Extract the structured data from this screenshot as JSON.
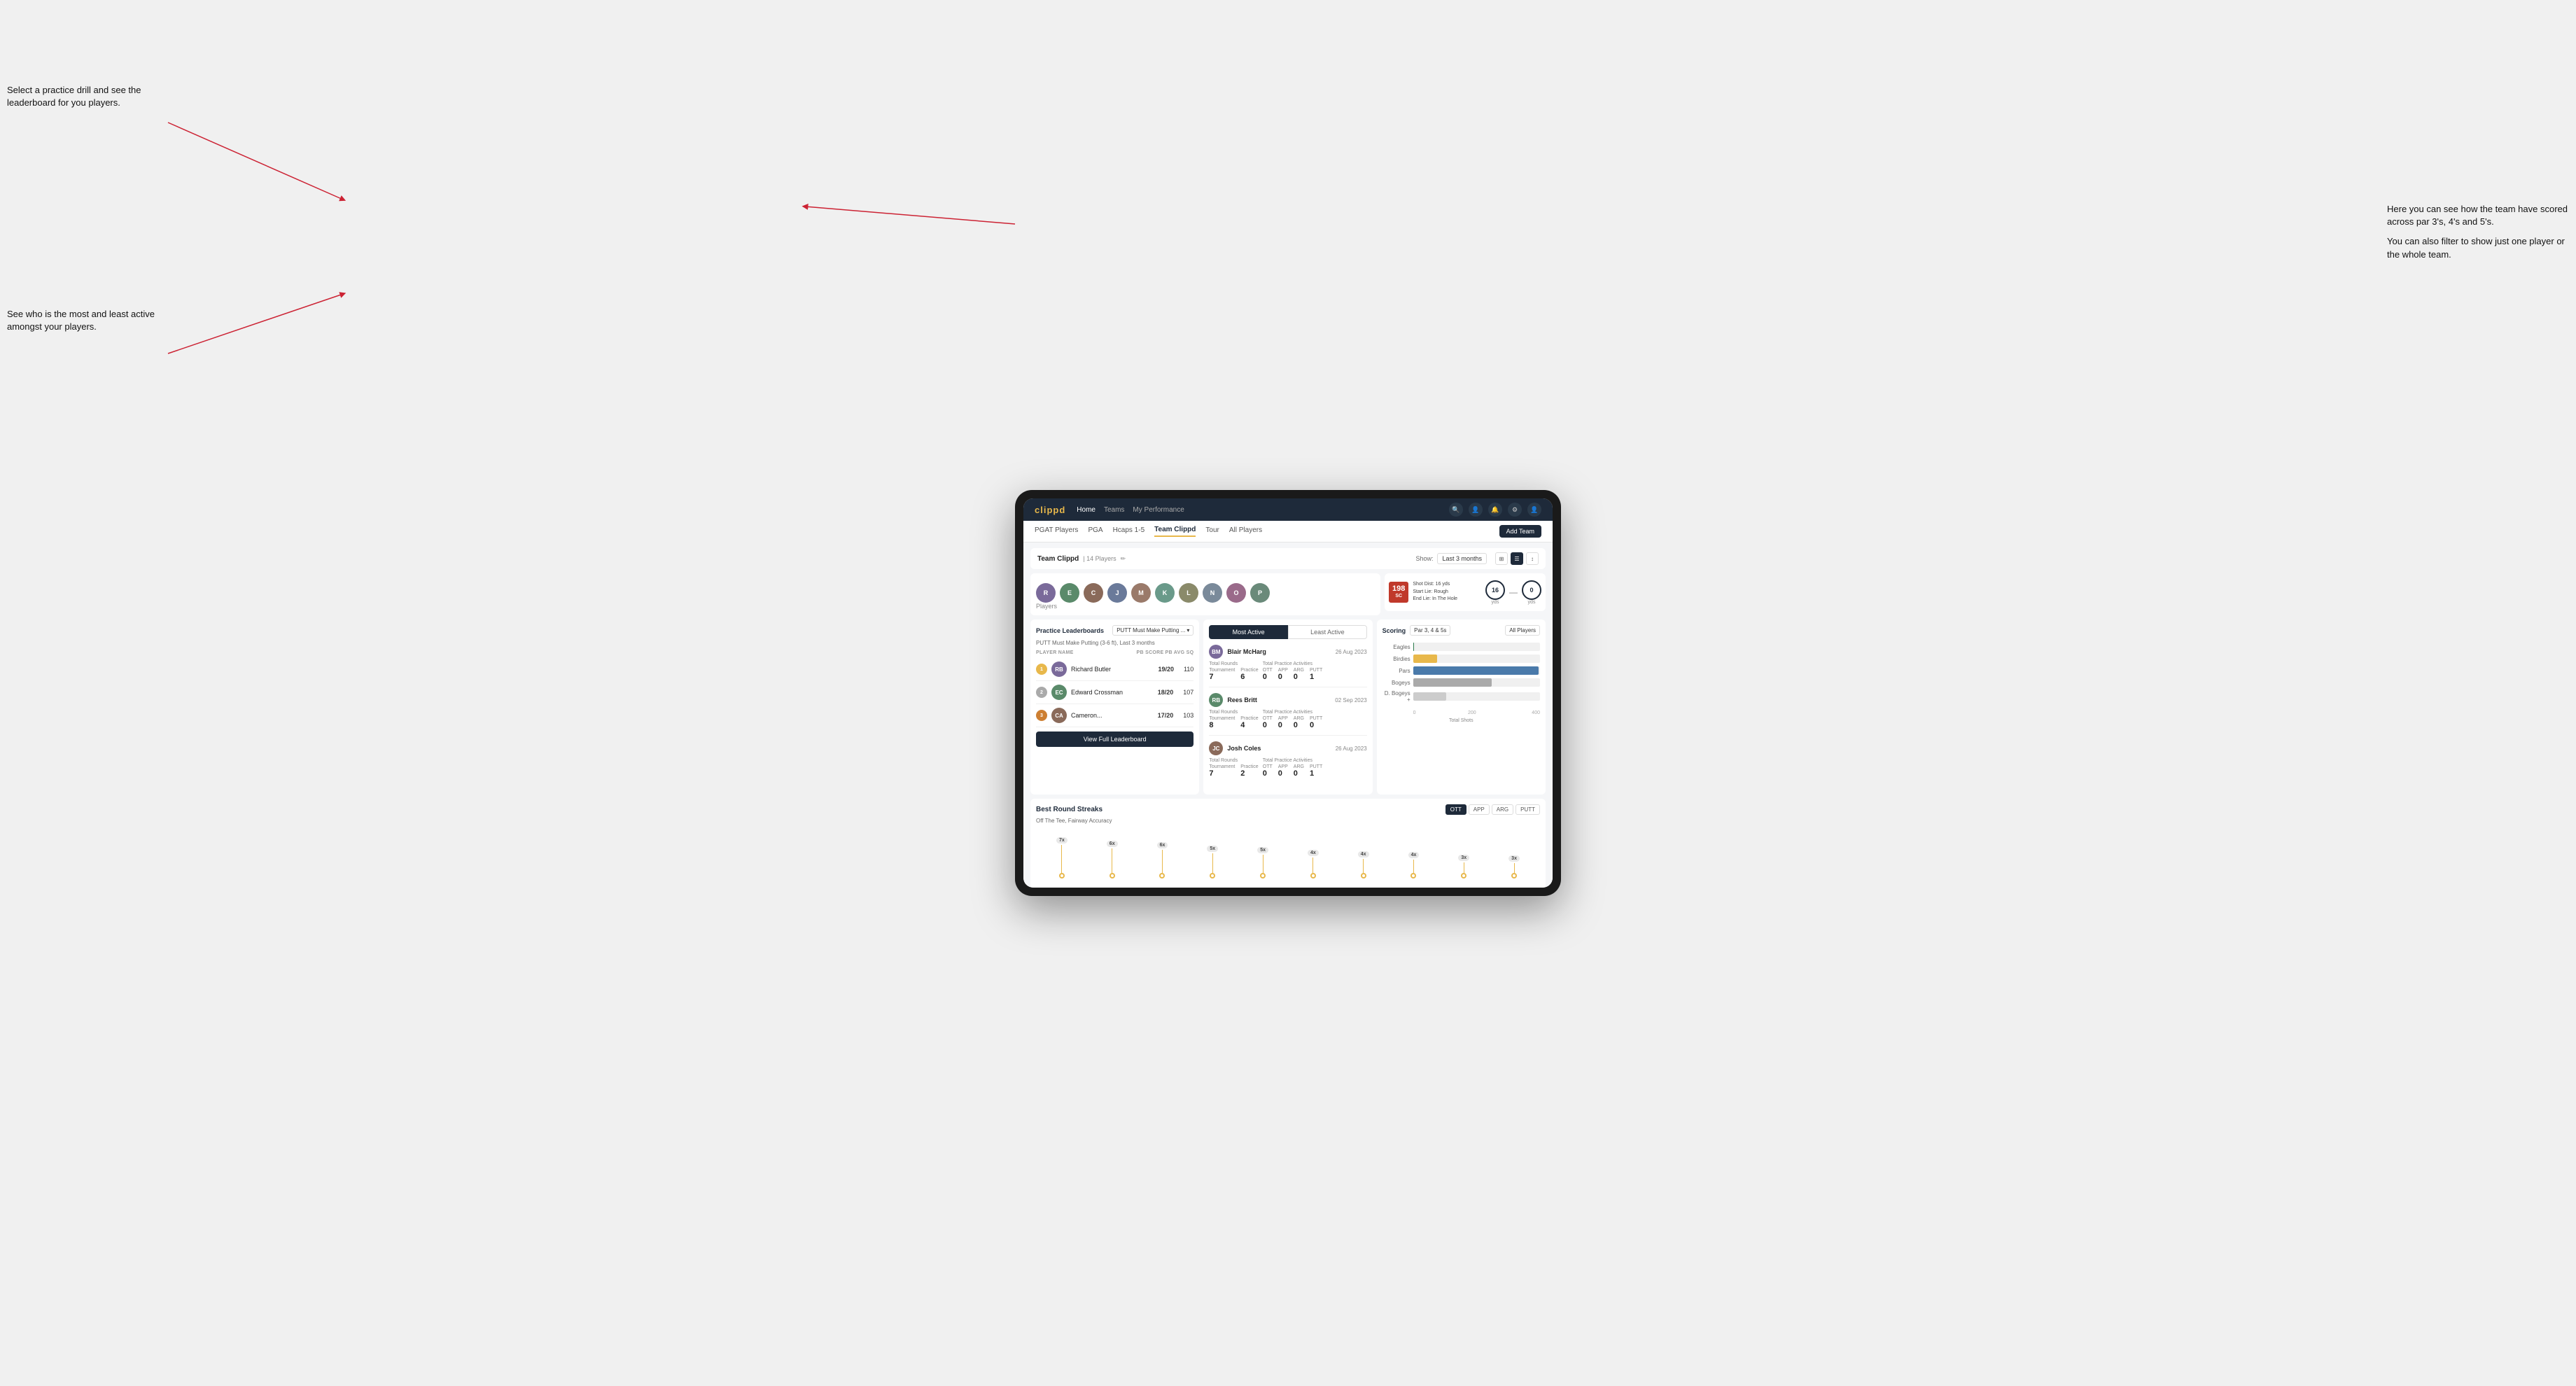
{
  "annotations": {
    "top_left": "Select a practice drill and see the leaderboard for you players.",
    "bottom_left": "See who is the most and least active amongst your players.",
    "top_right_line1": "Here you can see how the team have scored across par 3's, 4's and 5's.",
    "top_right_line2": "You can also filter to show just one player or the whole team."
  },
  "navbar": {
    "logo": "clippd",
    "links": [
      "Home",
      "Teams",
      "My Performance"
    ],
    "icons": [
      "🔍",
      "👤",
      "🔔",
      "⚙️",
      "👤"
    ]
  },
  "subnav": {
    "links": [
      "PGAT Players",
      "PGA",
      "Hcaps 1-5",
      "Team Clippd",
      "Tour",
      "All Players"
    ],
    "active": "Team Clippd",
    "add_btn": "Add Team"
  },
  "team": {
    "title": "Team Clippd",
    "count": "14 Players",
    "show_label": "Show:",
    "show_value": "Last 3 months",
    "players": [
      "R",
      "E",
      "C",
      "J",
      "M",
      "K",
      "L",
      "N",
      "O",
      "P"
    ]
  },
  "shot_info": {
    "badge_top": "198",
    "badge_sub": "SC",
    "details": "Shot Dist: 16 yds\nStart Lie: Rough\nEnd Lie: In The Hole",
    "circle1": "16",
    "circle1_unit": "yds",
    "circle2": "0",
    "circle2_unit": "yds"
  },
  "practice_leaderboards": {
    "title": "Practice Leaderboards",
    "drill": "PUTT Must Make Putting ...",
    "subtitle": "PUTT Must Make Putting (3-6 ft), Last 3 months",
    "col_headers": [
      "PLAYER NAME",
      "PB SCORE",
      "PB AVG SQ"
    ],
    "players": [
      {
        "rank": 1,
        "rank_type": "gold",
        "initials": "RB",
        "name": "Richard Butler",
        "score": "19/20",
        "avg": "110"
      },
      {
        "rank": 2,
        "rank_type": "silver",
        "initials": "EC",
        "name": "Edward Crossman",
        "score": "18/20",
        "avg": "107"
      },
      {
        "rank": 3,
        "rank_type": "bronze",
        "initials": "CA",
        "name": "Cameron...",
        "score": "17/20",
        "avg": "103"
      }
    ],
    "view_full_btn": "View Full Leaderboard"
  },
  "activity": {
    "tabs": [
      "Most Active",
      "Least Active"
    ],
    "active_tab": 0,
    "players": [
      {
        "name": "Blair McHarg",
        "date": "26 Aug 2023",
        "total_rounds_label": "Total Rounds",
        "tournament": "7",
        "practice": "6",
        "practice_activities_label": "Total Practice Activities",
        "ott": "0",
        "app": "0",
        "arg": "0",
        "putt": "1"
      },
      {
        "name": "Rees Britt",
        "date": "02 Sep 2023",
        "total_rounds_label": "Total Rounds",
        "tournament": "8",
        "practice": "4",
        "practice_activities_label": "Total Practice Activities",
        "ott": "0",
        "app": "0",
        "arg": "0",
        "putt": "0"
      },
      {
        "name": "Josh Coles",
        "date": "26 Aug 2023",
        "total_rounds_label": "Total Rounds",
        "tournament": "7",
        "practice": "2",
        "practice_activities_label": "Total Practice Activities",
        "ott": "0",
        "app": "0",
        "arg": "0",
        "putt": "1"
      }
    ]
  },
  "scoring": {
    "title": "Scoring",
    "filter1": "Par 3, 4 & 5s",
    "filter2": "All Players",
    "bars": [
      {
        "label": "Eagles",
        "value": 3,
        "max": 500,
        "color": "bar-eagles"
      },
      {
        "label": "Birdies",
        "value": 96,
        "max": 500,
        "color": "bar-birdies"
      },
      {
        "label": "Pars",
        "value": 499,
        "max": 500,
        "color": "bar-pars"
      },
      {
        "label": "Bogeys",
        "value": 311,
        "max": 500,
        "color": "bar-bogeys"
      },
      {
        "label": "D. Bogeys +",
        "value": 131,
        "max": 500,
        "color": "bar-dbogeys"
      }
    ],
    "axis": [
      "0",
      "200",
      "400"
    ],
    "total_shots": "Total Shots"
  },
  "streaks": {
    "title": "Best Round Streaks",
    "subtitle": "Off The Tee, Fairway Accuracy",
    "tabs": [
      "OTT",
      "APP",
      "ARG",
      "PUTT"
    ],
    "active_tab": 0,
    "data": [
      {
        "badge": "7x",
        "label": ""
      },
      {
        "badge": "6x",
        "label": ""
      },
      {
        "badge": "6x",
        "label": ""
      },
      {
        "badge": "5x",
        "label": ""
      },
      {
        "badge": "5x",
        "label": ""
      },
      {
        "badge": "4x",
        "label": ""
      },
      {
        "badge": "4x",
        "label": ""
      },
      {
        "badge": "4x",
        "label": ""
      },
      {
        "badge": "3x",
        "label": ""
      },
      {
        "badge": "3x",
        "label": ""
      }
    ]
  }
}
